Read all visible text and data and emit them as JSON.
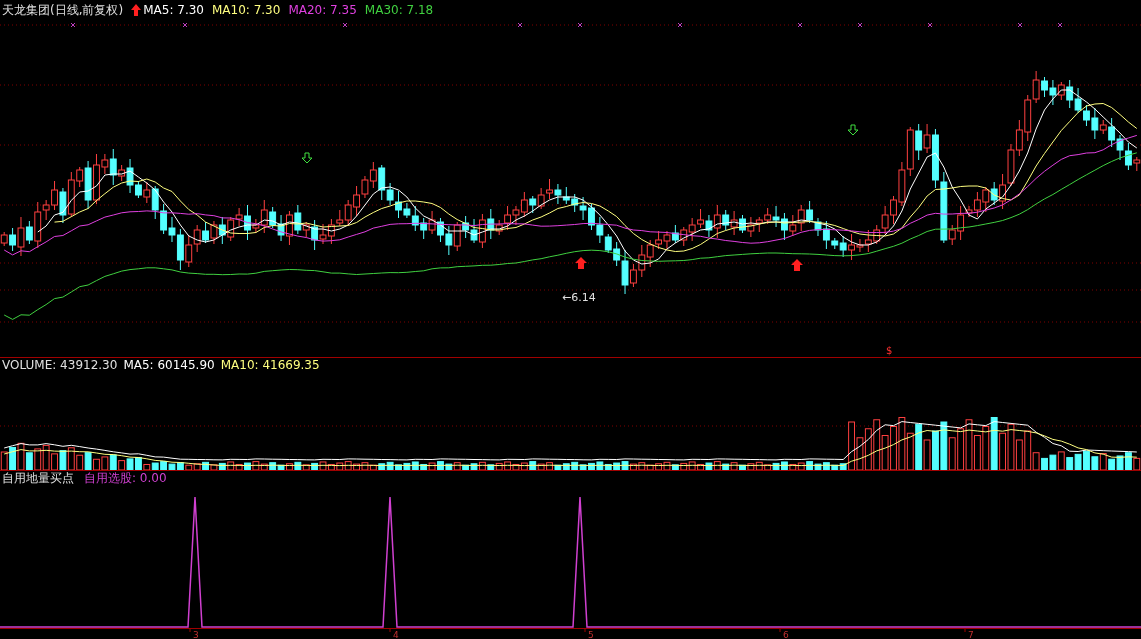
{
  "chart_header": {
    "title": "天龙集团(日线,前复权)",
    "indicators": [
      {
        "label": "MA5: 7.30",
        "color": "#ffffff"
      },
      {
        "label": "MA10: 7.30",
        "color": "#ffff80"
      },
      {
        "label": "MA20: 7.35",
        "color": "#e040e0"
      },
      {
        "label": "MA30: 7.18",
        "color": "#40d040"
      }
    ]
  },
  "price_chart": {
    "low_label": "←6.14",
    "signal_mark": "$"
  },
  "volume_header": {
    "title": "VOLUME: 43912.30",
    "indicators": [
      {
        "label": "MA5: 60145.90",
        "color": "#ffffff"
      },
      {
        "label": "MA10: 41669.35",
        "color": "#ffff80"
      }
    ]
  },
  "indicator_header": {
    "title": "自用地量买点",
    "readout": "自用选股: 0.00"
  },
  "time_axis": [
    "3",
    "4",
    "5",
    "6",
    "7"
  ]
}
